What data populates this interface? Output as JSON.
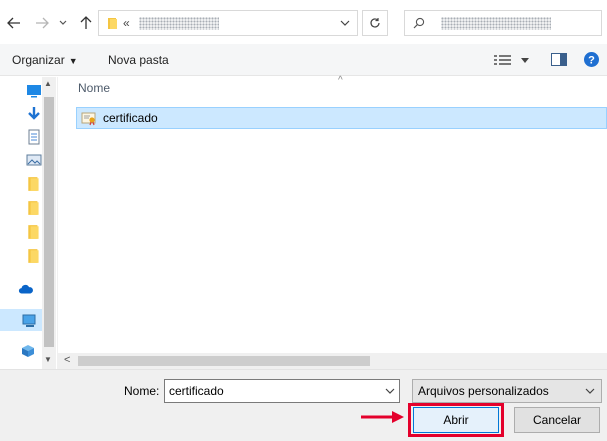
{
  "toolbar": {
    "back_icon": "arrow-left-icon",
    "forward_icon": "arrow-right-icon",
    "recent_icon": "chevron-down-icon",
    "up_icon": "arrow-up-icon",
    "crumb_separator": "«",
    "refresh_icon": "refresh-icon",
    "search_icon": "search-icon"
  },
  "commands": {
    "organize_label": "Organizar",
    "new_folder_label": "Nova pasta"
  },
  "file_list": {
    "column_name": "Nome",
    "items": [
      {
        "label": "certificado",
        "icon": "certificate-file-icon",
        "selected": true
      }
    ]
  },
  "footer": {
    "name_label": "Nome:",
    "name_value": "certificado",
    "filter_value": "Arquivos personalizados",
    "open_label": "Abrir",
    "cancel_label": "Cancelar"
  },
  "colors": {
    "selection": "#cce8ff",
    "selection_border": "#99d1ff",
    "accent": "#0078d7",
    "annotation": "#e4002b"
  }
}
